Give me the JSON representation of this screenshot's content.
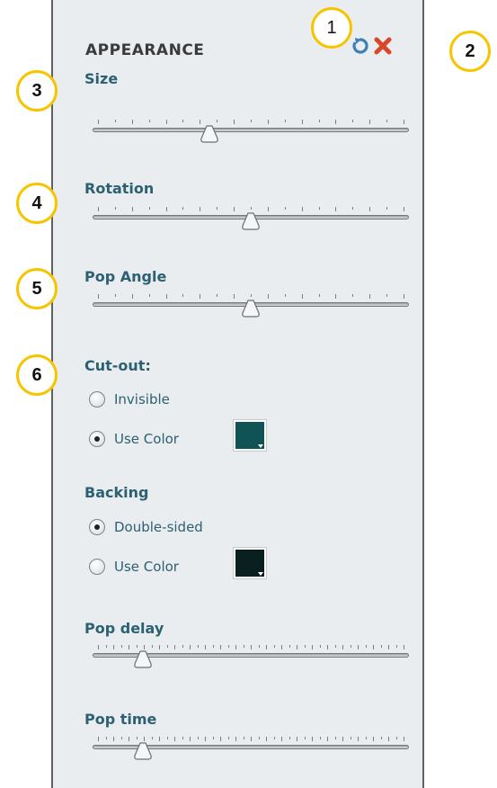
{
  "panel": {
    "title": "APPEARANCE",
    "icons": {
      "reset": "reset-icon",
      "close": "close-icon"
    }
  },
  "sliders": {
    "size": {
      "label": "Size",
      "value": 0.37
    },
    "rotation": {
      "label": "Rotation",
      "value": 0.5
    },
    "pop_angle": {
      "label": "Pop Angle",
      "value": 0.5
    },
    "pop_delay": {
      "label": "Pop delay",
      "value": 0.16
    },
    "pop_time": {
      "label": "Pop time",
      "value": 0.16
    }
  },
  "cutout": {
    "label": "Cut-out:",
    "options": [
      {
        "label": "Invisible",
        "checked": false
      },
      {
        "label": "Use Color",
        "checked": true
      }
    ],
    "color": "#0f5356"
  },
  "backing": {
    "label": "Backing",
    "options": [
      {
        "label": "Double-sided",
        "checked": true
      },
      {
        "label": "Use Color",
        "checked": false
      }
    ],
    "color": "#0a1f1f"
  },
  "callouts": [
    "1",
    "2",
    "3",
    "4",
    "5",
    "6"
  ],
  "colors": {
    "accent": "#2c6072",
    "callout_border": "#f7c500",
    "reset_icon": "#3d7fb8",
    "close_icon": "#d8472b"
  }
}
